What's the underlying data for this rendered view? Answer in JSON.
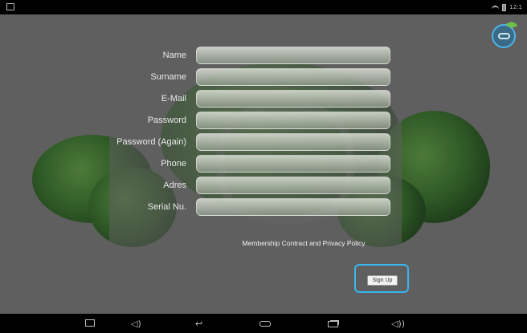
{
  "status_bar": {
    "time": "12:1"
  },
  "form": {
    "fields": [
      {
        "label": "Name",
        "value": ""
      },
      {
        "label": "Surname",
        "value": ""
      },
      {
        "label": "E-Mail",
        "value": ""
      },
      {
        "label": "Password",
        "value": ""
      },
      {
        "label": "Password (Again)",
        "value": ""
      },
      {
        "label": "Phone",
        "value": ""
      },
      {
        "label": "Adres",
        "value": ""
      },
      {
        "label": "Serial Nu.",
        "value": ""
      }
    ],
    "terms_link": "Membership Contract and Privacy Policy",
    "signup_label": "Sign Up"
  },
  "nav_bar": {
    "icons": [
      "screenshot-icon",
      "volume-down-icon",
      "back-icon",
      "home-icon",
      "recent-apps-icon",
      "volume-up-icon"
    ]
  },
  "colors": {
    "highlight": "#38b6f0",
    "background": "#5f5f5f"
  }
}
